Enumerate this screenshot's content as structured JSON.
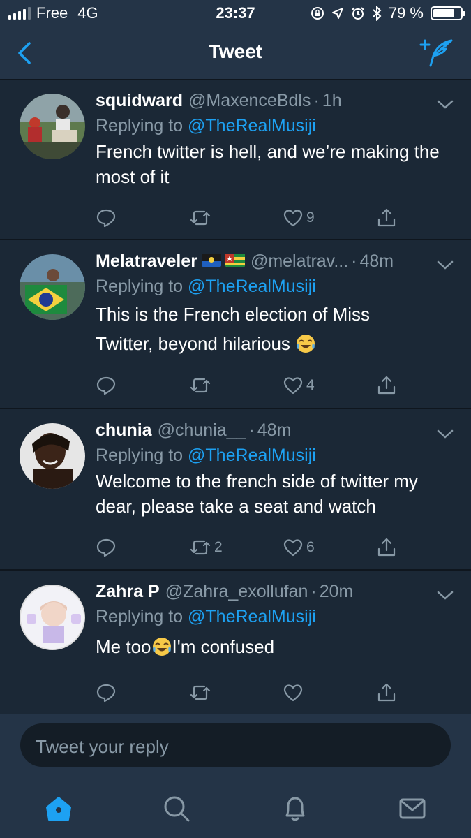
{
  "status_bar": {
    "carrier": "Free",
    "network": "4G",
    "time": "23:37",
    "battery_percent": "79 %",
    "battery_level": 0.79
  },
  "nav": {
    "title": "Tweet",
    "back_icon": "chevron-left-icon",
    "compose_icon": "compose-tweet-icon"
  },
  "tweets": [
    {
      "name": "squidward",
      "handle": "@MaxenceBdls",
      "time": "1h",
      "replying_prefix": "Replying to",
      "replying_to": "@TheRealMusiji",
      "text": "French twitter is hell, and we’re making the most of it",
      "retweets": "",
      "likes": "9"
    },
    {
      "name": "Melatraveler",
      "handle": "@melatrav...",
      "time": "48m",
      "replying_prefix": "Replying to",
      "replying_to": "@TheRealMusiji",
      "text_lines": [
        "This is the French election of Miss",
        "Twitter, beyond hilarious"
      ],
      "retweets": "",
      "likes": "4"
    },
    {
      "name": "chunia",
      "handle": "@chunia__",
      "time": "48m",
      "replying_prefix": "Replying to",
      "replying_to": "@TheRealMusiji",
      "text": "Welcome to the french side of twitter my dear, please take a seat and watch",
      "retweets": "2",
      "likes": "6"
    },
    {
      "name": "Zahra P",
      "handle": "@Zahra_exollufan",
      "time": "20m",
      "replying_prefix": "Replying to",
      "replying_to": "@TheRealMusiji",
      "text_before": "Me too",
      "text_after": "I'm confused",
      "retweets": "",
      "likes": ""
    }
  ],
  "composer": {
    "placeholder": "Tweet your reply"
  },
  "tabs": [
    {
      "icon": "home-icon",
      "active": true
    },
    {
      "icon": "search-icon",
      "active": false
    },
    {
      "icon": "bell-icon",
      "active": false
    },
    {
      "icon": "mail-icon",
      "active": false
    }
  ],
  "colors": {
    "accent": "#1da1f2",
    "background": "#141d26",
    "card": "#1b2836",
    "bar": "#243447",
    "muted": "#8899a6"
  }
}
